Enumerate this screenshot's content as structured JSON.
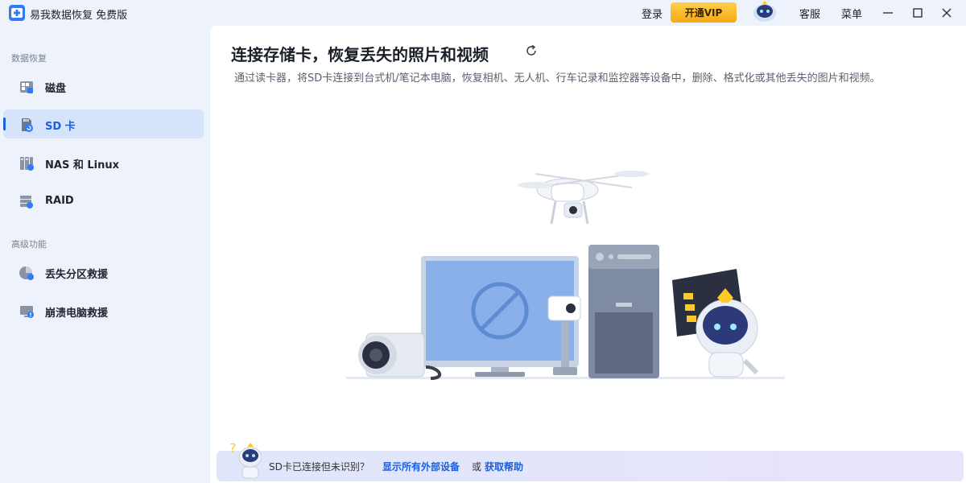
{
  "app": {
    "title": "易我数据恢复 免费版"
  },
  "titlebar": {
    "login_label": "登录",
    "vip_label": "开通VIP",
    "service_label": "客服",
    "menu_label": "菜单"
  },
  "sidebar": {
    "section_recovery": "数据恢复",
    "items": [
      {
        "label": "磁盘",
        "icon": "disk-icon"
      },
      {
        "label": "SD 卡",
        "icon": "sd-card-icon"
      },
      {
        "label": "NAS 和 Linux",
        "icon": "nas-icon"
      },
      {
        "label": "RAID",
        "icon": "raid-icon"
      }
    ],
    "section_advanced": "高级功能",
    "advanced_items": [
      {
        "label": "丢失分区救援",
        "icon": "partition-rescue-icon"
      },
      {
        "label": "崩溃电脑救援",
        "icon": "crashed-pc-icon"
      }
    ]
  },
  "main": {
    "title": "连接存储卡，恢复丢失的照片和视频",
    "description": "通过读卡器，将SD卡连接到台式机/笔记本电脑，恢复相机、无人机、行车记录和监控器等设备中，删除、格式化或其他丢失的图片和视频。"
  },
  "bottom_bar": {
    "text": "SD卡已连接但未识别？",
    "link_show_devices": "显示所有外部设备",
    "or_text": "或",
    "link_get_help": "获取帮助"
  },
  "colors": {
    "accent": "#1a5fe0",
    "vip_gold": "#f5a914",
    "active_bg": "#d6e4fb",
    "sidebar_bg": "#eef3fb"
  }
}
